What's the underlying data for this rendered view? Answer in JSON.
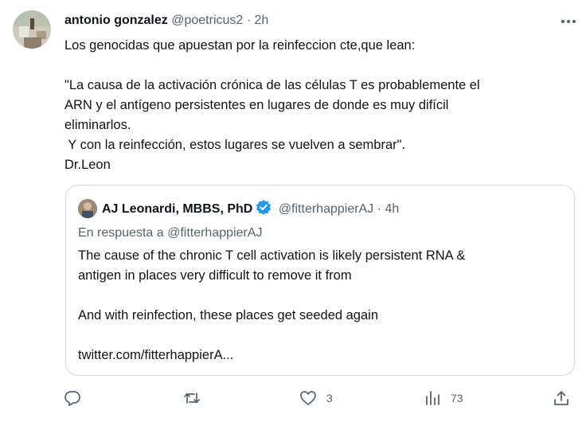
{
  "tweet": {
    "author_name": "antonio gonzalez",
    "author_handle": "@poetricus2",
    "separator": "·",
    "time": "2h",
    "lines": [
      "Los genocidas que apuestan por la reinfeccion cte,que lean:",
      "",
      "\"La causa de la activación crónica de las células T es probablemente el",
      "ARN y el antígeno persistentes en lugares de donde es muy difícil",
      "eliminarlos.",
      " Y con la reinfección, estos lugares se vuelven a sembrar\".",
      "Dr.Leon"
    ]
  },
  "quoted": {
    "author_name": "AJ Leonardi, MBBS, PhD",
    "author_handle": "@fitterhappierAJ",
    "separator": "·",
    "time": "4h",
    "reply_to": "En respuesta a @fitterhappierAJ",
    "lines": [
      "The cause of the chronic T cell activation is likely persistent RNA &",
      "antigen in places very difficult to remove it from",
      "",
      "And with reinfection, these places get seeded again",
      "",
      "twitter.com/fitterhappierA..."
    ],
    "verified_color": "#1d9bf0"
  },
  "actions": {
    "reply_count": "",
    "retweet_count": "",
    "like_count": "3",
    "views_count": "73"
  },
  "icons": {
    "more": "more-dots-icon",
    "reply": "reply-bubble-icon",
    "retweet": "retweet-icon",
    "like": "heart-icon",
    "views": "views-bar-chart-icon",
    "share": "share-icon"
  }
}
